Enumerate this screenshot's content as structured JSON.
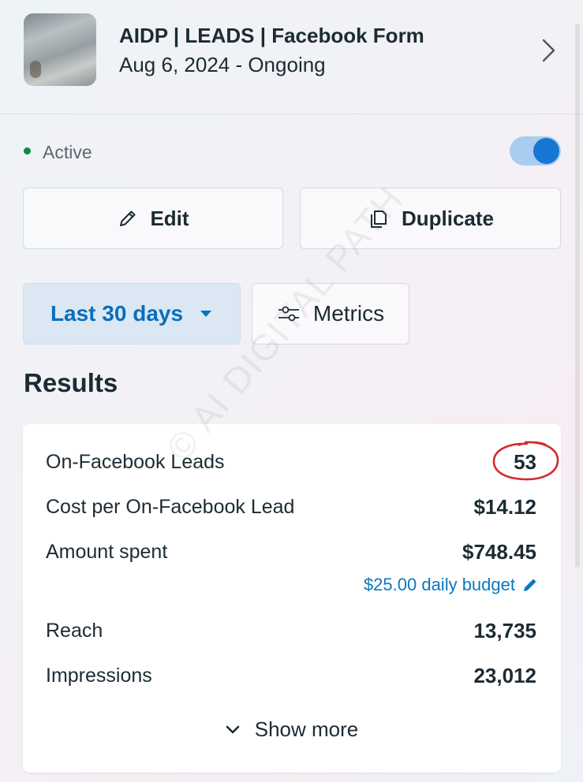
{
  "campaign": {
    "title": "AIDP | LEADS | Facebook Form",
    "dates": "Aug 6, 2024 -  Ongoing"
  },
  "status": {
    "label": "Active",
    "toggle_on": true,
    "dot_color": "#0a8a4c",
    "toggle_color": "#1877d3"
  },
  "actions": {
    "edit_label": "Edit",
    "duplicate_label": "Duplicate"
  },
  "filters": {
    "range_label": "Last 30 days",
    "metrics_label": "Metrics"
  },
  "results": {
    "title": "Results",
    "rows": [
      {
        "label": "On-Facebook Leads",
        "value": "53"
      },
      {
        "label": "Cost per On-Facebook Lead",
        "value": "$14.12"
      },
      {
        "label": "Amount spent",
        "value": "$748.45"
      },
      {
        "label": "Reach",
        "value": "13,735"
      },
      {
        "label": "Impressions",
        "value": "23,012"
      }
    ],
    "budget_link": "$25.00 daily budget",
    "show_more_label": "Show more"
  },
  "watermark": "© AI DIGITAL PATH",
  "colors": {
    "accent": "#0a6ebd",
    "annotation": "#d42a2a"
  }
}
